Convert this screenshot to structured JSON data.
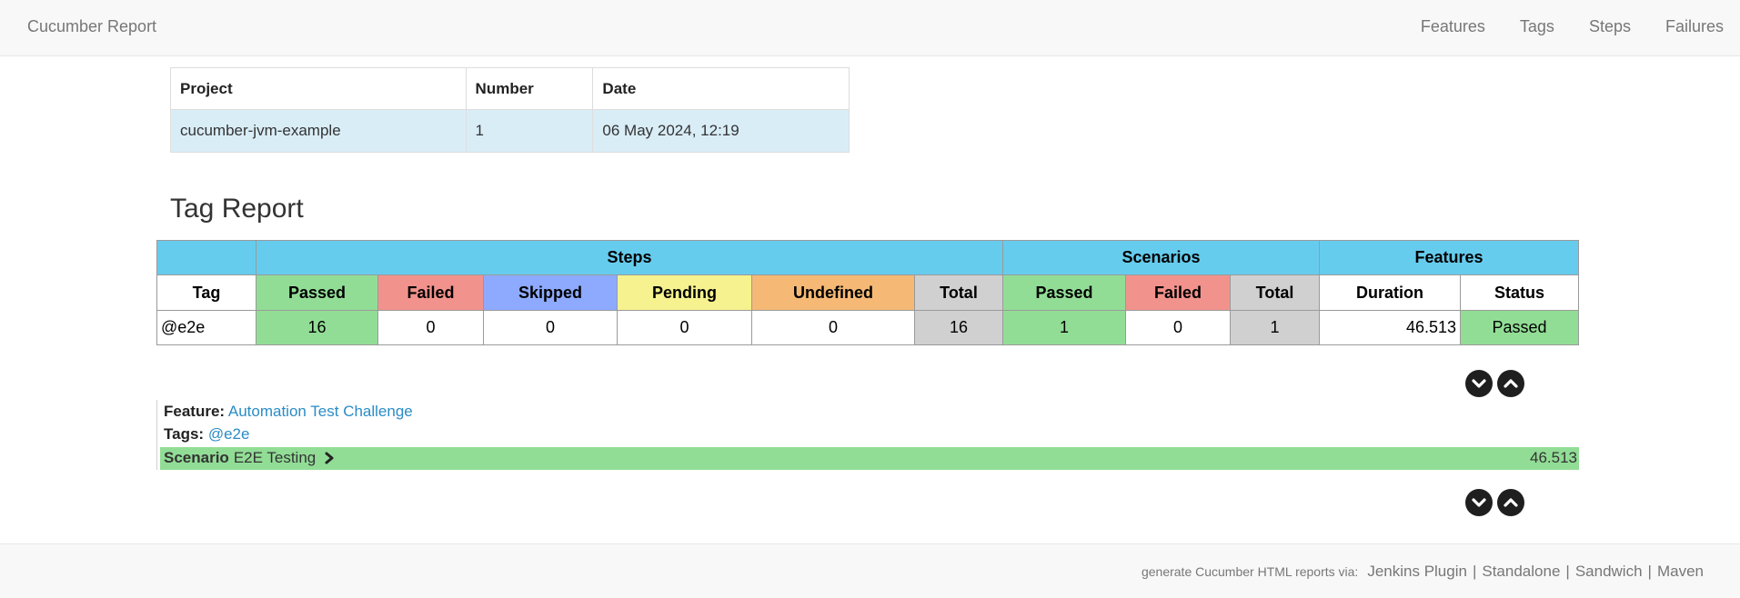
{
  "navbar": {
    "brand": "Cucumber Report",
    "links": [
      "Features",
      "Tags",
      "Steps",
      "Failures"
    ]
  },
  "build_info": {
    "headers": [
      "Project",
      "Number",
      "Date"
    ],
    "row": [
      "cucumber-jvm-example",
      "1",
      "06 May 2024, 12:19"
    ]
  },
  "tag_report": {
    "title": "Tag Report",
    "groups": {
      "steps": "Steps",
      "scenarios": "Scenarios",
      "features": "Features"
    },
    "columns": [
      "Tag",
      "Passed",
      "Failed",
      "Skipped",
      "Pending",
      "Undefined",
      "Total",
      "Passed",
      "Failed",
      "Total",
      "Duration",
      "Status"
    ],
    "row": {
      "tag": "@e2e",
      "steps_passed": "16",
      "steps_failed": "0",
      "steps_skipped": "0",
      "steps_pending": "0",
      "steps_undefined": "0",
      "steps_total": "16",
      "scenarios_passed": "1",
      "scenarios_failed": "0",
      "scenarios_total": "1",
      "duration": "46.513",
      "status": "Passed"
    }
  },
  "feature": {
    "feature_label": "Feature:",
    "feature_name": "Automation Test Challenge",
    "tags_label": "Tags:",
    "tag": "@e2e",
    "scenario_label": "Scenario",
    "scenario_name": "E2E Testing",
    "scenario_duration": "46.513"
  },
  "controls": {
    "icons": [
      "chevron-down-icon",
      "chevron-up-icon"
    ]
  },
  "footer": {
    "caption": "generate Cucumber HTML reports via:",
    "links": [
      "Jenkins Plugin",
      "Standalone",
      "Sandwich",
      "Maven"
    ],
    "separator": "|"
  },
  "colors": {
    "passed": "#92dd96",
    "failed": "#f2928c",
    "skipped": "#8daaff",
    "pending": "#f5f28f",
    "undefined": "#f5b975",
    "total": "#d0d0d0",
    "header": "#66ccee",
    "build_row": "#d9edf7",
    "link": "#2a8cc6"
  }
}
